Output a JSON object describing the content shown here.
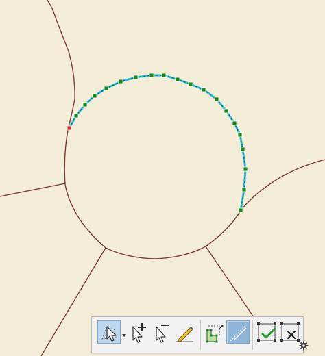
{
  "map": {
    "background": "#f3ecd6",
    "boundary_color": "#7a3b2e",
    "sketch_line_color": "#27c4d8",
    "vertex_color": "#138a13",
    "start_vertex_color": "#d62c2c"
  },
  "toolbar": {
    "tools": [
      {
        "icon": "select-vertex-icon",
        "active": true
      },
      {
        "icon": "dropdown-arrow-icon",
        "active": false
      },
      {
        "icon": "add-vertex-icon",
        "active": false
      },
      {
        "icon": "delete-vertex-icon",
        "active": false
      },
      {
        "icon": "pencil-icon",
        "active": false
      },
      {
        "icon": "reshape-icon",
        "active": false
      },
      {
        "icon": "continue-feature-icon",
        "active": true
      },
      {
        "icon": "finish-sketch-icon",
        "active": false
      },
      {
        "icon": "discard-sketch-icon",
        "active": false
      }
    ],
    "settings_icon": "gear-icon"
  }
}
